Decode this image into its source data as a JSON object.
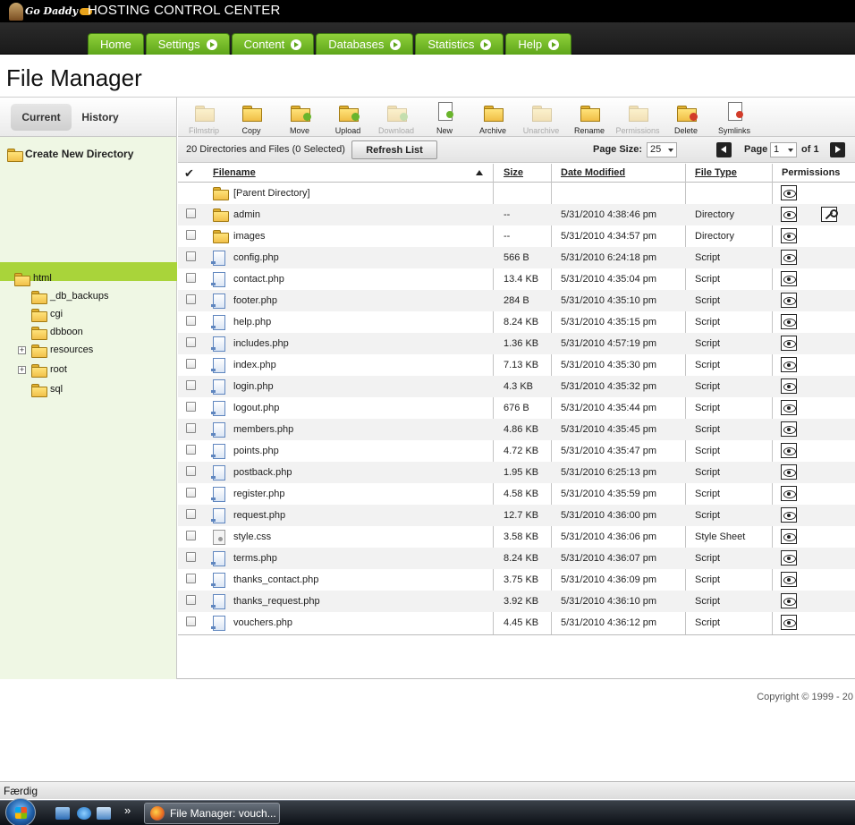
{
  "header": {
    "logo_text": "Go Daddy",
    "app_title": "HOSTING CONTROL CENTER"
  },
  "nav": {
    "tabs": [
      {
        "label": "Home",
        "has_arrow": false
      },
      {
        "label": "Settings",
        "has_arrow": true
      },
      {
        "label": "Content",
        "has_arrow": true
      },
      {
        "label": "Databases",
        "has_arrow": true
      },
      {
        "label": "Statistics",
        "has_arrow": true
      },
      {
        "label": "Help",
        "has_arrow": true
      }
    ]
  },
  "page": {
    "title": "File Manager"
  },
  "sidebar": {
    "tabs": {
      "current": "Current",
      "history": "History",
      "active": "Current"
    },
    "create_dir_label": "Create New Directory",
    "tree": [
      {
        "label": "html",
        "depth": 0,
        "expandable": false,
        "selected": false
      },
      {
        "label": "_db_backups",
        "depth": 1,
        "expandable": false,
        "selected": false
      },
      {
        "label": "cgi",
        "depth": 1,
        "expandable": false,
        "selected": false
      },
      {
        "label": "dbboon",
        "depth": 1,
        "expandable": false,
        "selected": false
      },
      {
        "label": "resources",
        "depth": 1,
        "expandable": true,
        "selected": false
      },
      {
        "label": "root",
        "depth": 1,
        "expandable": true,
        "selected": true
      },
      {
        "label": "sql",
        "depth": 1,
        "expandable": false,
        "selected": false
      }
    ]
  },
  "toolbar": {
    "tools": [
      {
        "label": "Filmstrip",
        "icon": "filmstrip-icon",
        "enabled": false
      },
      {
        "label": "Copy",
        "icon": "copy-icon",
        "enabled": true
      },
      {
        "label": "Move",
        "icon": "move-icon",
        "enabled": true
      },
      {
        "label": "Upload",
        "icon": "upload-icon",
        "enabled": true
      },
      {
        "label": "Download",
        "icon": "download-icon",
        "enabled": false
      },
      {
        "label": "New",
        "icon": "new-file-icon",
        "enabled": true
      },
      {
        "label": "Archive",
        "icon": "archive-icon",
        "enabled": true
      },
      {
        "label": "Unarchive",
        "icon": "unarchive-icon",
        "enabled": false
      },
      {
        "label": "Rename",
        "icon": "rename-icon",
        "enabled": true
      },
      {
        "label": "Permissions",
        "icon": "permissions-icon",
        "enabled": false
      },
      {
        "label": "Delete",
        "icon": "delete-icon",
        "enabled": true
      },
      {
        "label": "Symlinks",
        "icon": "symlinks-icon",
        "enabled": true
      }
    ]
  },
  "listing": {
    "count_text": "20 Directories and Files (0 Selected)",
    "refresh_label": "Refresh List",
    "page_size_label": "Page Size:",
    "page_size_value": "25",
    "page_label": "Page",
    "page_value": "1",
    "page_of": "of 1"
  },
  "table": {
    "columns": {
      "filename": "Filename",
      "size": "Size",
      "date": "Date Modified",
      "type": "File Type",
      "permissions": "Permissions"
    },
    "sort_column": "filename",
    "sort_dir": "ascending",
    "rows": [
      {
        "name": "[Parent Directory]",
        "kind": "parent",
        "size": "",
        "date": "",
        "type": "",
        "has_key": false
      },
      {
        "name": "admin",
        "kind": "folder",
        "size": "--",
        "date": "5/31/2010 4:38:46 pm",
        "type": "Directory",
        "has_key": true
      },
      {
        "name": "images",
        "kind": "folder",
        "size": "--",
        "date": "5/31/2010 4:34:57 pm",
        "type": "Directory",
        "has_key": false
      },
      {
        "name": "config.php",
        "kind": "script",
        "size": "566 B",
        "date": "5/31/2010 6:24:18 pm",
        "type": "Script",
        "has_key": false
      },
      {
        "name": "contact.php",
        "kind": "script",
        "size": "13.4 KB",
        "date": "5/31/2010 4:35:04 pm",
        "type": "Script",
        "has_key": false
      },
      {
        "name": "footer.php",
        "kind": "script",
        "size": "284 B",
        "date": "5/31/2010 4:35:10 pm",
        "type": "Script",
        "has_key": false
      },
      {
        "name": "help.php",
        "kind": "script",
        "size": "8.24 KB",
        "date": "5/31/2010 4:35:15 pm",
        "type": "Script",
        "has_key": false
      },
      {
        "name": "includes.php",
        "kind": "script",
        "size": "1.36 KB",
        "date": "5/31/2010 4:57:19 pm",
        "type": "Script",
        "has_key": false
      },
      {
        "name": "index.php",
        "kind": "script",
        "size": "7.13 KB",
        "date": "5/31/2010 4:35:30 pm",
        "type": "Script",
        "has_key": false
      },
      {
        "name": "login.php",
        "kind": "script",
        "size": "4.3 KB",
        "date": "5/31/2010 4:35:32 pm",
        "type": "Script",
        "has_key": false
      },
      {
        "name": "logout.php",
        "kind": "script",
        "size": "676 B",
        "date": "5/31/2010 4:35:44 pm",
        "type": "Script",
        "has_key": false
      },
      {
        "name": "members.php",
        "kind": "script",
        "size": "4.86 KB",
        "date": "5/31/2010 4:35:45 pm",
        "type": "Script",
        "has_key": false
      },
      {
        "name": "points.php",
        "kind": "script",
        "size": "4.72 KB",
        "date": "5/31/2010 4:35:47 pm",
        "type": "Script",
        "has_key": false
      },
      {
        "name": "postback.php",
        "kind": "script",
        "size": "1.95 KB",
        "date": "5/31/2010 6:25:13 pm",
        "type": "Script",
        "has_key": false
      },
      {
        "name": "register.php",
        "kind": "script",
        "size": "4.58 KB",
        "date": "5/31/2010 4:35:59 pm",
        "type": "Script",
        "has_key": false
      },
      {
        "name": "request.php",
        "kind": "script",
        "size": "12.7 KB",
        "date": "5/31/2010 4:36:00 pm",
        "type": "Script",
        "has_key": false
      },
      {
        "name": "style.css",
        "kind": "stylesheet",
        "size": "3.58 KB",
        "date": "5/31/2010 4:36:06 pm",
        "type": "Style Sheet",
        "has_key": false
      },
      {
        "name": "terms.php",
        "kind": "script",
        "size": "8.24 KB",
        "date": "5/31/2010 4:36:07 pm",
        "type": "Script",
        "has_key": false
      },
      {
        "name": "thanks_contact.php",
        "kind": "script",
        "size": "3.75 KB",
        "date": "5/31/2010 4:36:09 pm",
        "type": "Script",
        "has_key": false
      },
      {
        "name": "thanks_request.php",
        "kind": "script",
        "size": "3.92 KB",
        "date": "5/31/2010 4:36:10 pm",
        "type": "Script",
        "has_key": false
      },
      {
        "name": "vouchers.php",
        "kind": "script",
        "size": "4.45 KB",
        "date": "5/31/2010 4:36:12 pm",
        "type": "Script",
        "has_key": false
      }
    ]
  },
  "footer": {
    "copyright": "Copyright © 1999 - 20"
  },
  "statusbar": {
    "text": "Færdig"
  },
  "taskbar": {
    "overflow_label": "»",
    "window_button_label": "File Manager: vouch..."
  },
  "colors": {
    "nav_green": "#6ab42c",
    "sidebar_bg": "#eff7e4",
    "selected_tree": "#a9d43a",
    "header_bg": "#000000"
  }
}
